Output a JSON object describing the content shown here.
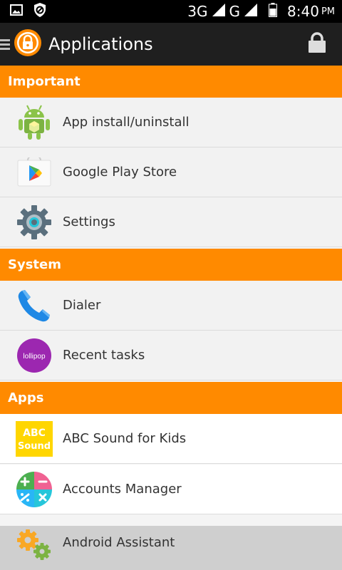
{
  "status_bar": {
    "network_3g": "3G",
    "network_g": "G",
    "time": "8:40",
    "ampm": "PM"
  },
  "app_bar": {
    "title": "Applications"
  },
  "sections": [
    {
      "title": "Important"
    },
    {
      "title": "System"
    },
    {
      "title": "Apps"
    }
  ],
  "items": [
    {
      "label": "App install/uninstall",
      "icon": "android-robot-icon"
    },
    {
      "label": "Google Play Store",
      "icon": "play-store-icon"
    },
    {
      "label": "Settings",
      "icon": "gear-icon"
    },
    {
      "label": "Dialer",
      "icon": "phone-icon"
    },
    {
      "label": "Recent tasks",
      "icon": "lollipop-icon",
      "icon_text": "lollipop"
    },
    {
      "label": "ABC Sound for Kids",
      "icon": "abc-sound-icon",
      "icon_text_1": "ABC",
      "icon_text_2": "Sound"
    },
    {
      "label": "Accounts Manager",
      "icon": "calculator-icon"
    },
    {
      "label": "Android Assistant",
      "icon": "gears-icon"
    }
  ],
  "colors": {
    "accent": "#ff8a00",
    "appbar": "#1f1f1f"
  }
}
